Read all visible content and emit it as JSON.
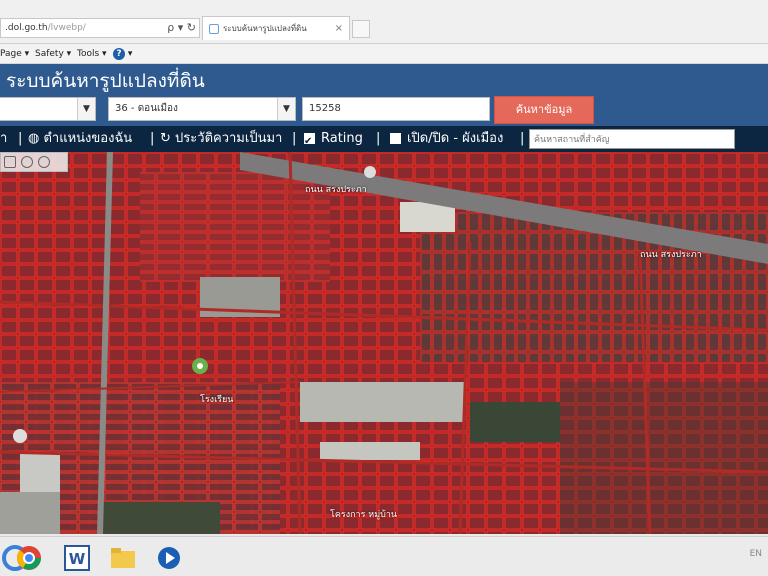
{
  "browser": {
    "address_host": ".dol.go.th",
    "address_path": "/lvwebp/",
    "address_icons": "ρ ▾ ↻",
    "tab_title": "ระบบค้นหารูปแปลงที่ดิน",
    "tab_close": "×",
    "menu": {
      "page": "Page ▾",
      "safety": "Safety ▾",
      "tools": "Tools ▾",
      "help": "?",
      "help_arrow": "▾"
    }
  },
  "app": {
    "title": "ระบบค้นหารูปแปลงที่ดิน",
    "province_value": "",
    "district_value": "36 - ดอนเมือง",
    "parcel_value": "15258",
    "search_label": "ค้นหาข้อมูล"
  },
  "toolbar": {
    "home_label": "ำ",
    "my_location_label": "ตำแหน่งของฉัน",
    "history_label": "ประวัติความเป็นมา",
    "rating_label": "Rating",
    "rating_checked": true,
    "cityplan_label": "เปิด/ปิด - ผังเมือง",
    "cityplan_checked": false,
    "place_search_placeholder": "ค้นหาสถานที่สำคัญ",
    "separator": "|"
  },
  "map": {
    "road_label_top": "ถนน สรงประภา",
    "road_label_right": "ถนน สรงประภา",
    "road_label_bottom": "โครงการ หมู่บ้าน",
    "parcel_color": "#e0261e",
    "label_near_center": "โรงเรียน"
  },
  "taskbar": {
    "tray_text": "EN"
  }
}
